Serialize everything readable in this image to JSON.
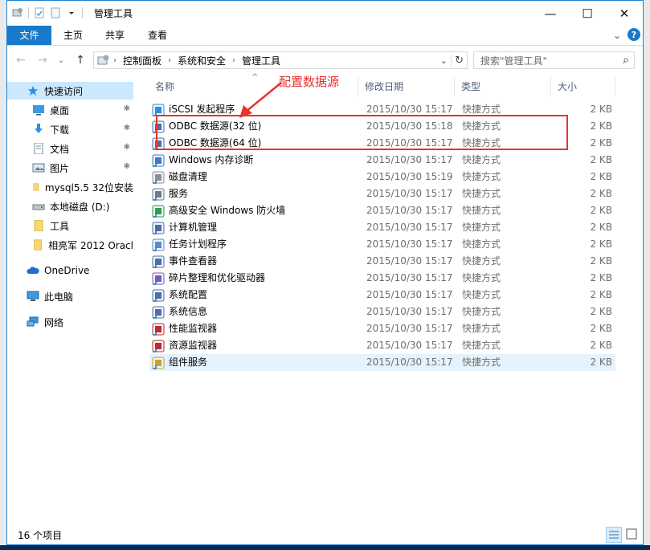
{
  "window": {
    "title": "管理工具",
    "min_glyph": "—",
    "max_glyph": "☐",
    "close_glyph": "✕"
  },
  "ribbon": {
    "tabs": [
      "文件",
      "主页",
      "共享",
      "查看"
    ],
    "help_glyph": "?",
    "expand_glyph": "⌄"
  },
  "nav": {
    "back_glyph": "←",
    "forward_glyph": "→",
    "recent_glyph": "⌄",
    "up_glyph": "↑"
  },
  "address": {
    "crumbs": [
      "控制面板",
      "系统和安全",
      "管理工具"
    ],
    "dropdown_glyph": "⌄",
    "refresh_glyph": "↻"
  },
  "search": {
    "placeholder": "搜索\"管理工具\"",
    "icon_glyph": "⌕"
  },
  "sidebar": {
    "quick_access": "快速访问",
    "items": [
      {
        "label": "桌面",
        "pinned": true
      },
      {
        "label": "下载",
        "pinned": true
      },
      {
        "label": "文档",
        "pinned": true
      },
      {
        "label": "图片",
        "pinned": true
      },
      {
        "label": "mysql5.5 32位安装",
        "pinned": false
      },
      {
        "label": "本地磁盘 (D:)",
        "pinned": false
      },
      {
        "label": "工具",
        "pinned": false
      },
      {
        "label": "相亮军 2012 Oracl",
        "pinned": false
      }
    ],
    "onedrive": "OneDrive",
    "this_pc": "此电脑",
    "network": "网络",
    "pin_glyph": "✱"
  },
  "columns": {
    "name": "名称",
    "date": "修改日期",
    "type": "类型",
    "size": "大小",
    "sort_glyph": "^"
  },
  "files": [
    {
      "name": "iSCSI 发起程序",
      "date": "2015/10/30 15:17",
      "type": "快捷方式",
      "size": "2 KB"
    },
    {
      "name": "ODBC 数据源(32 位)",
      "date": "2015/10/30 15:18",
      "type": "快捷方式",
      "size": "2 KB"
    },
    {
      "name": "ODBC 数据源(64 位)",
      "date": "2015/10/30 15:17",
      "type": "快捷方式",
      "size": "2 KB"
    },
    {
      "name": "Windows 内存诊断",
      "date": "2015/10/30 15:17",
      "type": "快捷方式",
      "size": "2 KB"
    },
    {
      "name": "磁盘清理",
      "date": "2015/10/30 15:19",
      "type": "快捷方式",
      "size": "2 KB"
    },
    {
      "name": "服务",
      "date": "2015/10/30 15:17",
      "type": "快捷方式",
      "size": "2 KB"
    },
    {
      "name": "高级安全 Windows 防火墙",
      "date": "2015/10/30 15:17",
      "type": "快捷方式",
      "size": "2 KB"
    },
    {
      "name": "计算机管理",
      "date": "2015/10/30 15:17",
      "type": "快捷方式",
      "size": "2 KB"
    },
    {
      "name": "任务计划程序",
      "date": "2015/10/30 15:17",
      "type": "快捷方式",
      "size": "2 KB"
    },
    {
      "name": "事件查看器",
      "date": "2015/10/30 15:17",
      "type": "快捷方式",
      "size": "2 KB"
    },
    {
      "name": "碎片整理和优化驱动器",
      "date": "2015/10/30 15:17",
      "type": "快捷方式",
      "size": "2 KB"
    },
    {
      "name": "系统配置",
      "date": "2015/10/30 15:17",
      "type": "快捷方式",
      "size": "2 KB"
    },
    {
      "name": "系统信息",
      "date": "2015/10/30 15:17",
      "type": "快捷方式",
      "size": "2 KB"
    },
    {
      "name": "性能监视器",
      "date": "2015/10/30 15:17",
      "type": "快捷方式",
      "size": "2 KB"
    },
    {
      "name": "资源监视器",
      "date": "2015/10/30 15:17",
      "type": "快捷方式",
      "size": "2 KB"
    },
    {
      "name": "组件服务",
      "date": "2015/10/30 15:17",
      "type": "快捷方式",
      "size": "2 KB"
    }
  ],
  "annotation": {
    "text": "配置数据源"
  },
  "status": {
    "item_count": "16 个项目"
  },
  "colors": {
    "accent": "#1979ca",
    "selection": "#cce8ff",
    "highlight": "#e8322c"
  }
}
